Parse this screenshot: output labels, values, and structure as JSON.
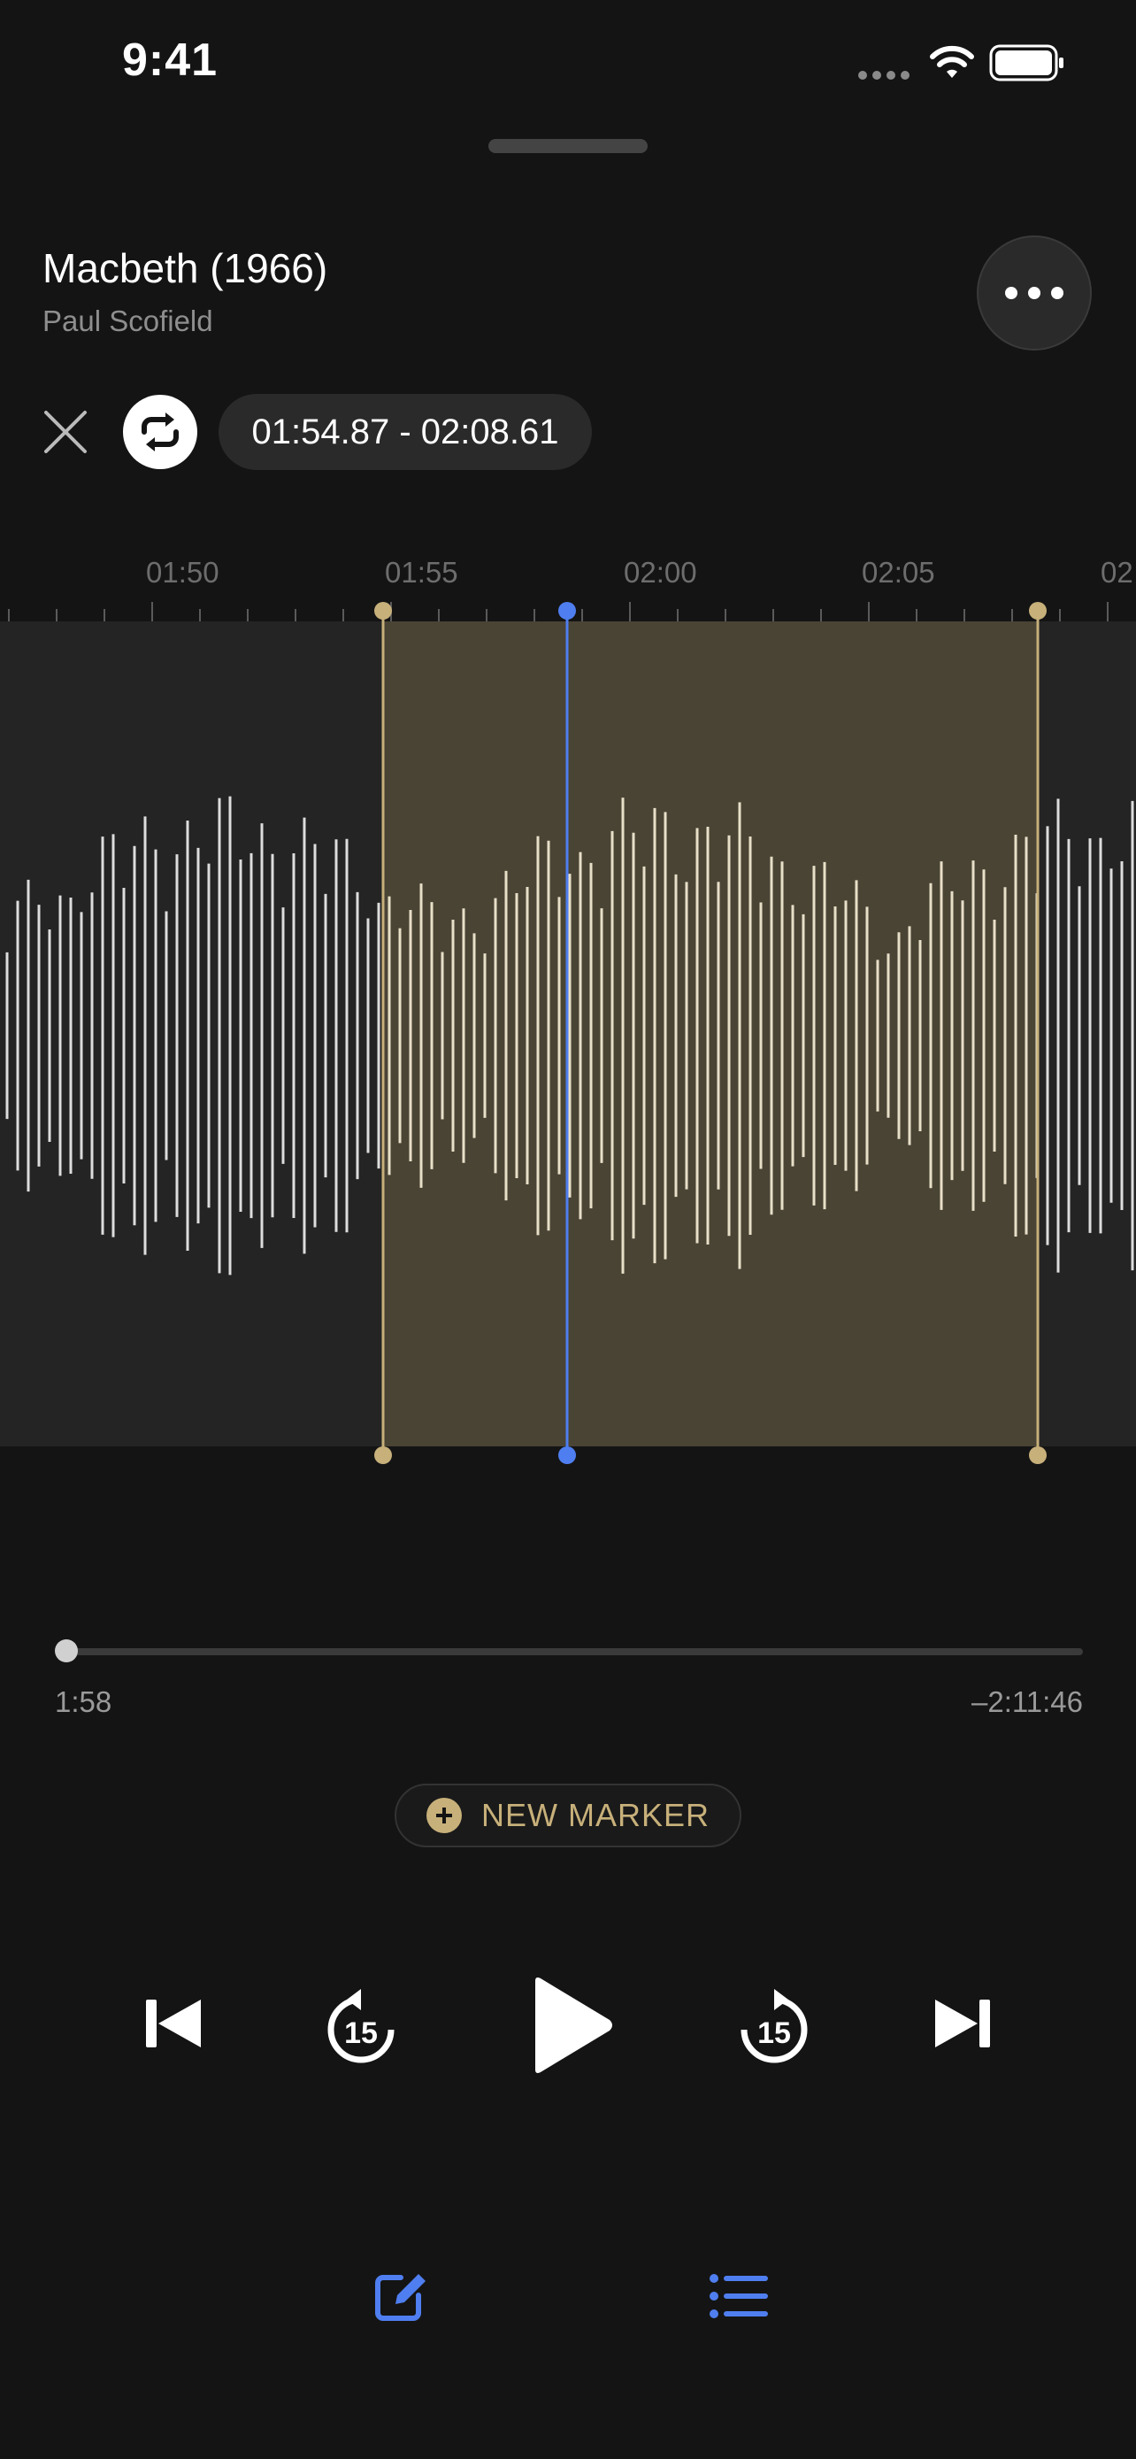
{
  "status_bar": {
    "time": "9:41"
  },
  "track": {
    "title": "Macbeth (1966)",
    "artist": "Paul Scofield"
  },
  "loop": {
    "range": "01:54.87 - 02:08.61"
  },
  "ruler": {
    "labels": [
      "01:50",
      "01:55",
      "02:00",
      "02:05",
      "02"
    ]
  },
  "progress": {
    "elapsed": "1:58",
    "remaining": "–2:11:46",
    "fraction": 0.0125
  },
  "marker_button": {
    "label": "NEW MARKER"
  },
  "playback": {
    "skip_back_seconds": "15",
    "skip_forward_seconds": "15"
  },
  "colors": {
    "background": "#141414",
    "accent_gold": "#c7b07a",
    "playhead_blue": "#4f7ef0",
    "selection": "#4a4435"
  },
  "icons": {
    "more": "more-dots-icon",
    "close": "close-icon",
    "loop": "repeat-icon",
    "prev": "skip-previous-icon",
    "rewind": "rewind-15-icon",
    "play": "play-icon",
    "forward": "forward-15-icon",
    "next": "skip-next-icon",
    "edit": "edit-icon",
    "list": "list-icon"
  }
}
